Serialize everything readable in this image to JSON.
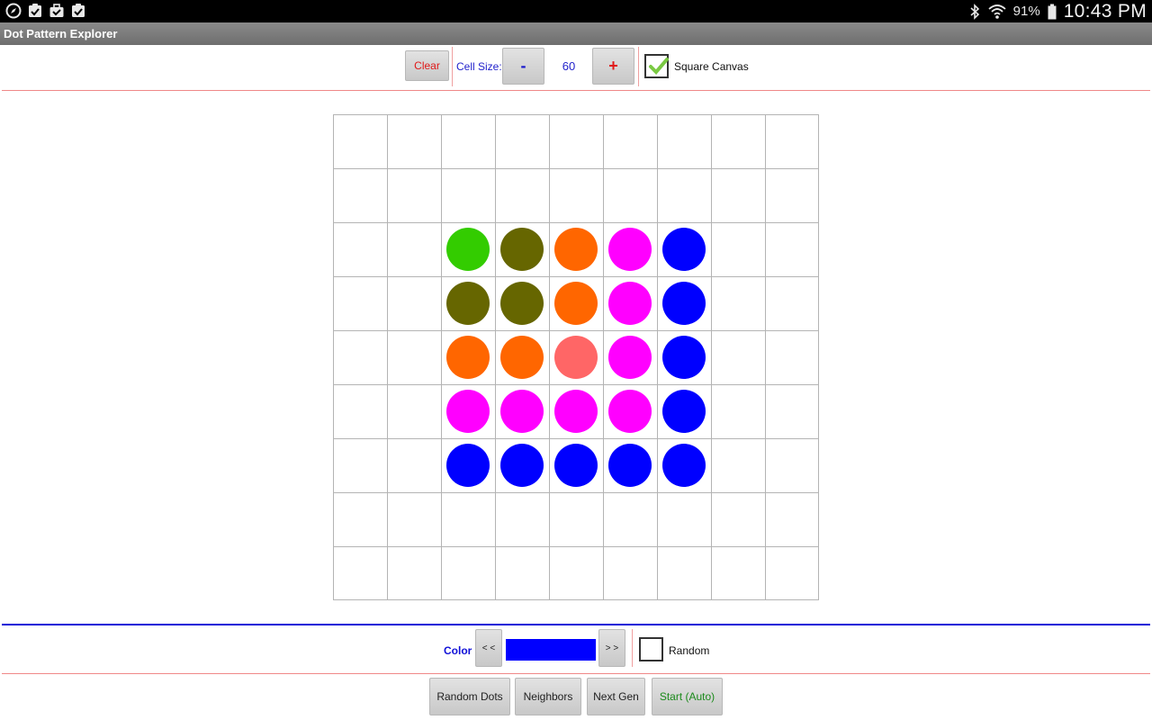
{
  "status_bar": {
    "left_icons": [
      "compass-icon",
      "clipboard-check-icon",
      "briefcase-icon",
      "clipboard-check-icon"
    ],
    "battery_percent": "91%",
    "time": "10:43 PM"
  },
  "app": {
    "title": "Dot Pattern Explorer"
  },
  "toolbar": {
    "clear_label": "Clear",
    "cell_size_label": "Cell Size:",
    "minus_label": "-",
    "cell_size_value": "60",
    "plus_label": "+",
    "square_canvas_label": "Square Canvas",
    "square_canvas_checked": true
  },
  "grid": {
    "rows": 9,
    "cols": 9,
    "line_color": "#b4b4b4",
    "dots": [
      {
        "row": 2,
        "col": 2,
        "color": "#33cc00"
      },
      {
        "row": 2,
        "col": 3,
        "color": "#666600"
      },
      {
        "row": 2,
        "col": 4,
        "color": "#ff6600"
      },
      {
        "row": 2,
        "col": 5,
        "color": "#ff00ff"
      },
      {
        "row": 2,
        "col": 6,
        "color": "#0000ff"
      },
      {
        "row": 3,
        "col": 2,
        "color": "#666600"
      },
      {
        "row": 3,
        "col": 3,
        "color": "#666600"
      },
      {
        "row": 3,
        "col": 4,
        "color": "#ff6600"
      },
      {
        "row": 3,
        "col": 5,
        "color": "#ff00ff"
      },
      {
        "row": 3,
        "col": 6,
        "color": "#0000ff"
      },
      {
        "row": 4,
        "col": 2,
        "color": "#ff6600"
      },
      {
        "row": 4,
        "col": 3,
        "color": "#ff6600"
      },
      {
        "row": 4,
        "col": 4,
        "color": "#ff6666"
      },
      {
        "row": 4,
        "col": 5,
        "color": "#ff00ff"
      },
      {
        "row": 4,
        "col": 6,
        "color": "#0000ff"
      },
      {
        "row": 5,
        "col": 2,
        "color": "#ff00ff"
      },
      {
        "row": 5,
        "col": 3,
        "color": "#ff00ff"
      },
      {
        "row": 5,
        "col": 4,
        "color": "#ff00ff"
      },
      {
        "row": 5,
        "col": 5,
        "color": "#ff00ff"
      },
      {
        "row": 5,
        "col": 6,
        "color": "#0000ff"
      },
      {
        "row": 6,
        "col": 2,
        "color": "#0000ff"
      },
      {
        "row": 6,
        "col": 3,
        "color": "#0000ff"
      },
      {
        "row": 6,
        "col": 4,
        "color": "#0000ff"
      },
      {
        "row": 6,
        "col": 5,
        "color": "#0000ff"
      },
      {
        "row": 6,
        "col": 6,
        "color": "#0000ff"
      }
    ]
  },
  "color_picker": {
    "label": "Color",
    "prev_label": "< <",
    "next_label": "> >",
    "current_color": "#0000ff",
    "random_label": "Random",
    "random_checked": false
  },
  "bottom_buttons": {
    "random_dots": "Random Dots",
    "neighbors": "Neighbors",
    "next_gen": "Next Gen",
    "start": "Start (Auto)"
  },
  "colors": {
    "accent_red": "#e01818",
    "accent_blue": "#1010d8",
    "start_green": "#1b8a1b"
  }
}
